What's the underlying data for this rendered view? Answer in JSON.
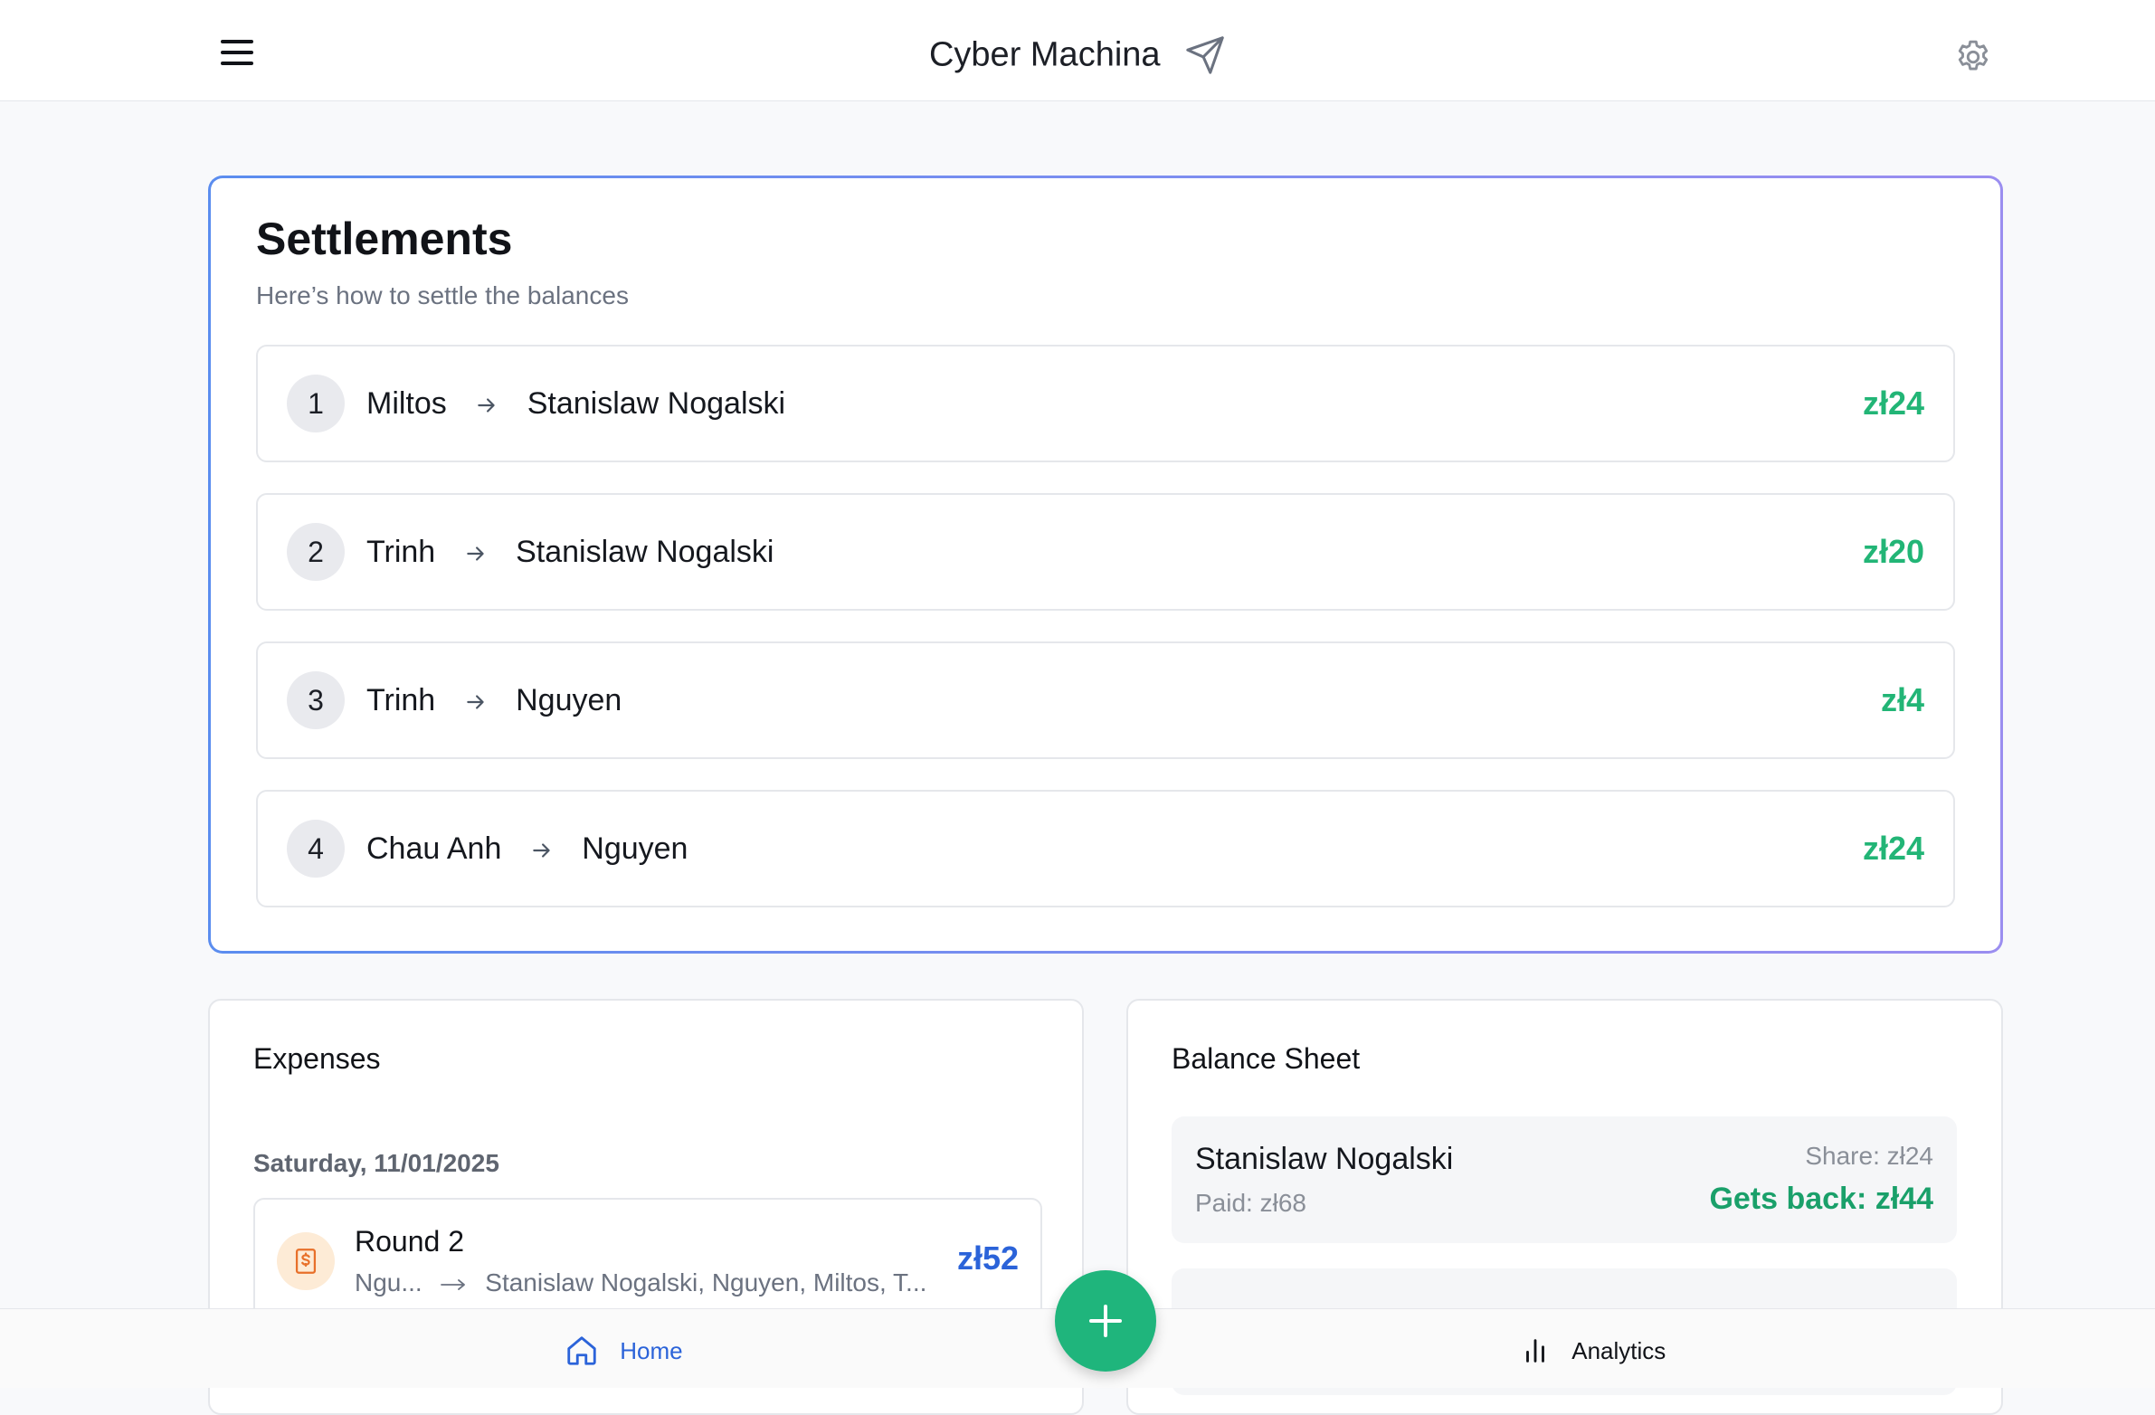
{
  "header": {
    "title": "Cyber Machina",
    "menu_icon": "hamburger-menu-icon",
    "brand_icon": "paper-plane-icon",
    "settings_icon": "gear-icon"
  },
  "settlements": {
    "title": "Settlements",
    "subtitle": "Here’s how to settle the balances",
    "items": [
      {
        "index": "1",
        "from": "Miltos",
        "to": "Stanislaw Nogalski",
        "amount": "zł24"
      },
      {
        "index": "2",
        "from": "Trinh",
        "to": "Stanislaw Nogalski",
        "amount": "zł20"
      },
      {
        "index": "3",
        "from": "Trinh",
        "to": "Nguyen",
        "amount": "zł4"
      },
      {
        "index": "4",
        "from": "Chau Anh",
        "to": "Nguyen",
        "amount": "zł24"
      }
    ]
  },
  "expenses": {
    "title": "Expenses",
    "date": "Saturday, 11/01/2025",
    "items": [
      {
        "title": "Round 2",
        "payer": "Ngu...",
        "participants": "Stanislaw Nogalski, Nguyen, Miltos, T...",
        "amount": "zł52",
        "icon": "receipt-dollar-icon"
      }
    ]
  },
  "balance_sheet": {
    "title": "Balance Sheet",
    "items": [
      {
        "name": "Stanislaw Nogalski",
        "paid": "Paid: zł68",
        "share": "Share: zł24",
        "gets_back": "Gets back: zł44"
      }
    ]
  },
  "bottom_nav": {
    "home": "Home",
    "analytics": "Analytics",
    "add_icon": "plus-icon"
  },
  "colors": {
    "accent_green": "#22b576",
    "accent_blue": "#2b63d9",
    "card_border_gradient": [
      "#5b8def",
      "#9b8ef0"
    ]
  }
}
